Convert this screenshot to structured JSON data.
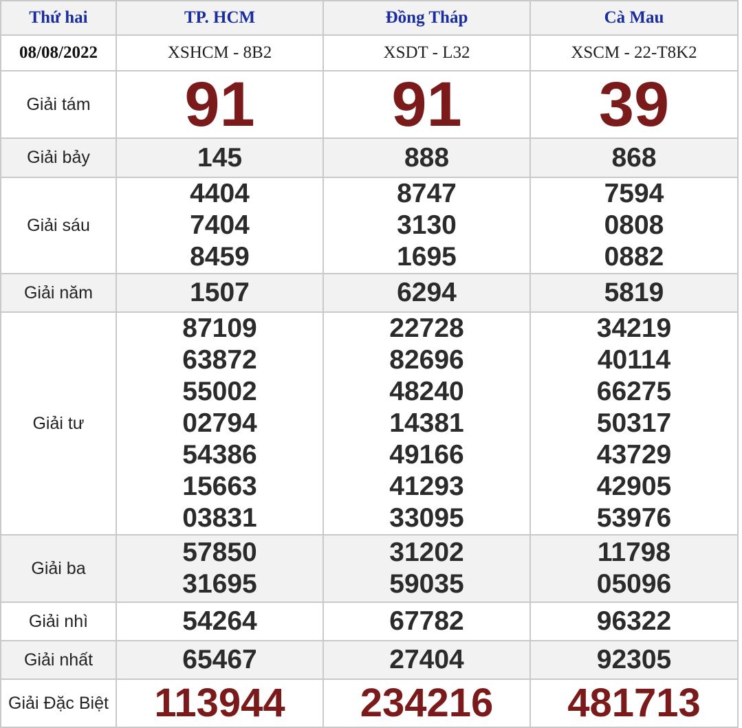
{
  "header": {
    "day": "Thứ hai",
    "provinces": [
      "TP. HCM",
      "Đồng Tháp",
      "Cà Mau"
    ]
  },
  "draw": {
    "date": "08/08/2022",
    "codes": [
      "XSHCM - 8B2",
      "XSDT - L32",
      "XSCM - 22-T8K2"
    ]
  },
  "prizes": [
    {
      "label": "Giải tám",
      "values": [
        [
          "91"
        ],
        [
          "91"
        ],
        [
          "39"
        ]
      ]
    },
    {
      "label": "Giải bảy",
      "values": [
        [
          "145"
        ],
        [
          "888"
        ],
        [
          "868"
        ]
      ]
    },
    {
      "label": "Giải sáu",
      "values": [
        [
          "4404",
          "7404",
          "8459"
        ],
        [
          "8747",
          "3130",
          "1695"
        ],
        [
          "7594",
          "0808",
          "0882"
        ]
      ]
    },
    {
      "label": "Giải năm",
      "values": [
        [
          "1507"
        ],
        [
          "6294"
        ],
        [
          "5819"
        ]
      ]
    },
    {
      "label": "Giải tư",
      "values": [
        [
          "87109",
          "63872",
          "55002",
          "02794",
          "54386",
          "15663",
          "03831"
        ],
        [
          "22728",
          "82696",
          "48240",
          "14381",
          "49166",
          "41293",
          "33095"
        ],
        [
          "34219",
          "40114",
          "66275",
          "50317",
          "43729",
          "42905",
          "53976"
        ]
      ]
    },
    {
      "label": "Giải ba",
      "values": [
        [
          "57850",
          "31695"
        ],
        [
          "31202",
          "59035"
        ],
        [
          "11798",
          "05096"
        ]
      ]
    },
    {
      "label": "Giải nhì",
      "values": [
        [
          "54264"
        ],
        [
          "67782"
        ],
        [
          "96322"
        ]
      ]
    },
    {
      "label": "Giải nhất",
      "values": [
        [
          "65467"
        ],
        [
          "27404"
        ],
        [
          "92305"
        ]
      ]
    },
    {
      "label": "Giải Đặc Biệt",
      "values": [
        [
          "113944"
        ],
        [
          "234216"
        ],
        [
          "481713"
        ]
      ]
    }
  ],
  "colors": {
    "header_text": "#1a2d9e",
    "prize_highlight": "#7a1a1a",
    "number_text": "#2b2b2b",
    "row_shade": "#f2f2f2",
    "border": "#c9c9c9"
  }
}
